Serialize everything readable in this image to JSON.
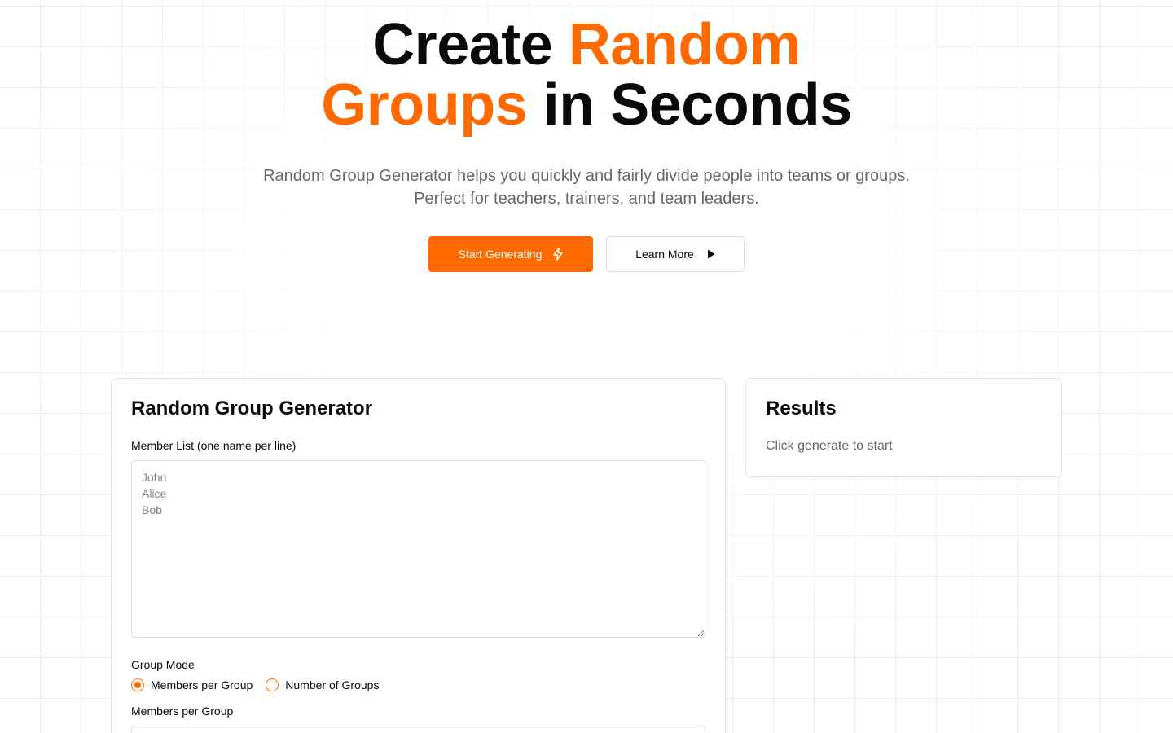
{
  "hero": {
    "title_part1": "Create ",
    "title_accent1": "Random",
    "title_accent2": "Groups",
    "title_part2": " in Seconds",
    "subtitle_line1": "Random Group Generator helps you quickly and fairly divide people into teams or groups.",
    "subtitle_line2": "Perfect for teachers, trainers, and team leaders.",
    "primary_button": "Start Generating",
    "secondary_button": "Learn More"
  },
  "generator": {
    "title": "Random Group Generator",
    "member_list_label": "Member List (one name per line)",
    "member_list_placeholder": "John\nAlice\nBob",
    "group_mode_label": "Group Mode",
    "mode_options": [
      "Members per Group",
      "Number of Groups"
    ],
    "selected_mode": "Members per Group",
    "members_per_group_label": "Members per Group"
  },
  "results": {
    "title": "Results",
    "hint": "Click generate to start"
  },
  "colors": {
    "accent": "#ff6a00",
    "text": "#0a0a0a",
    "muted": "#6b6661"
  },
  "icons": {
    "primary_button_icon": "lightning-icon",
    "secondary_button_icon": "play-icon"
  }
}
